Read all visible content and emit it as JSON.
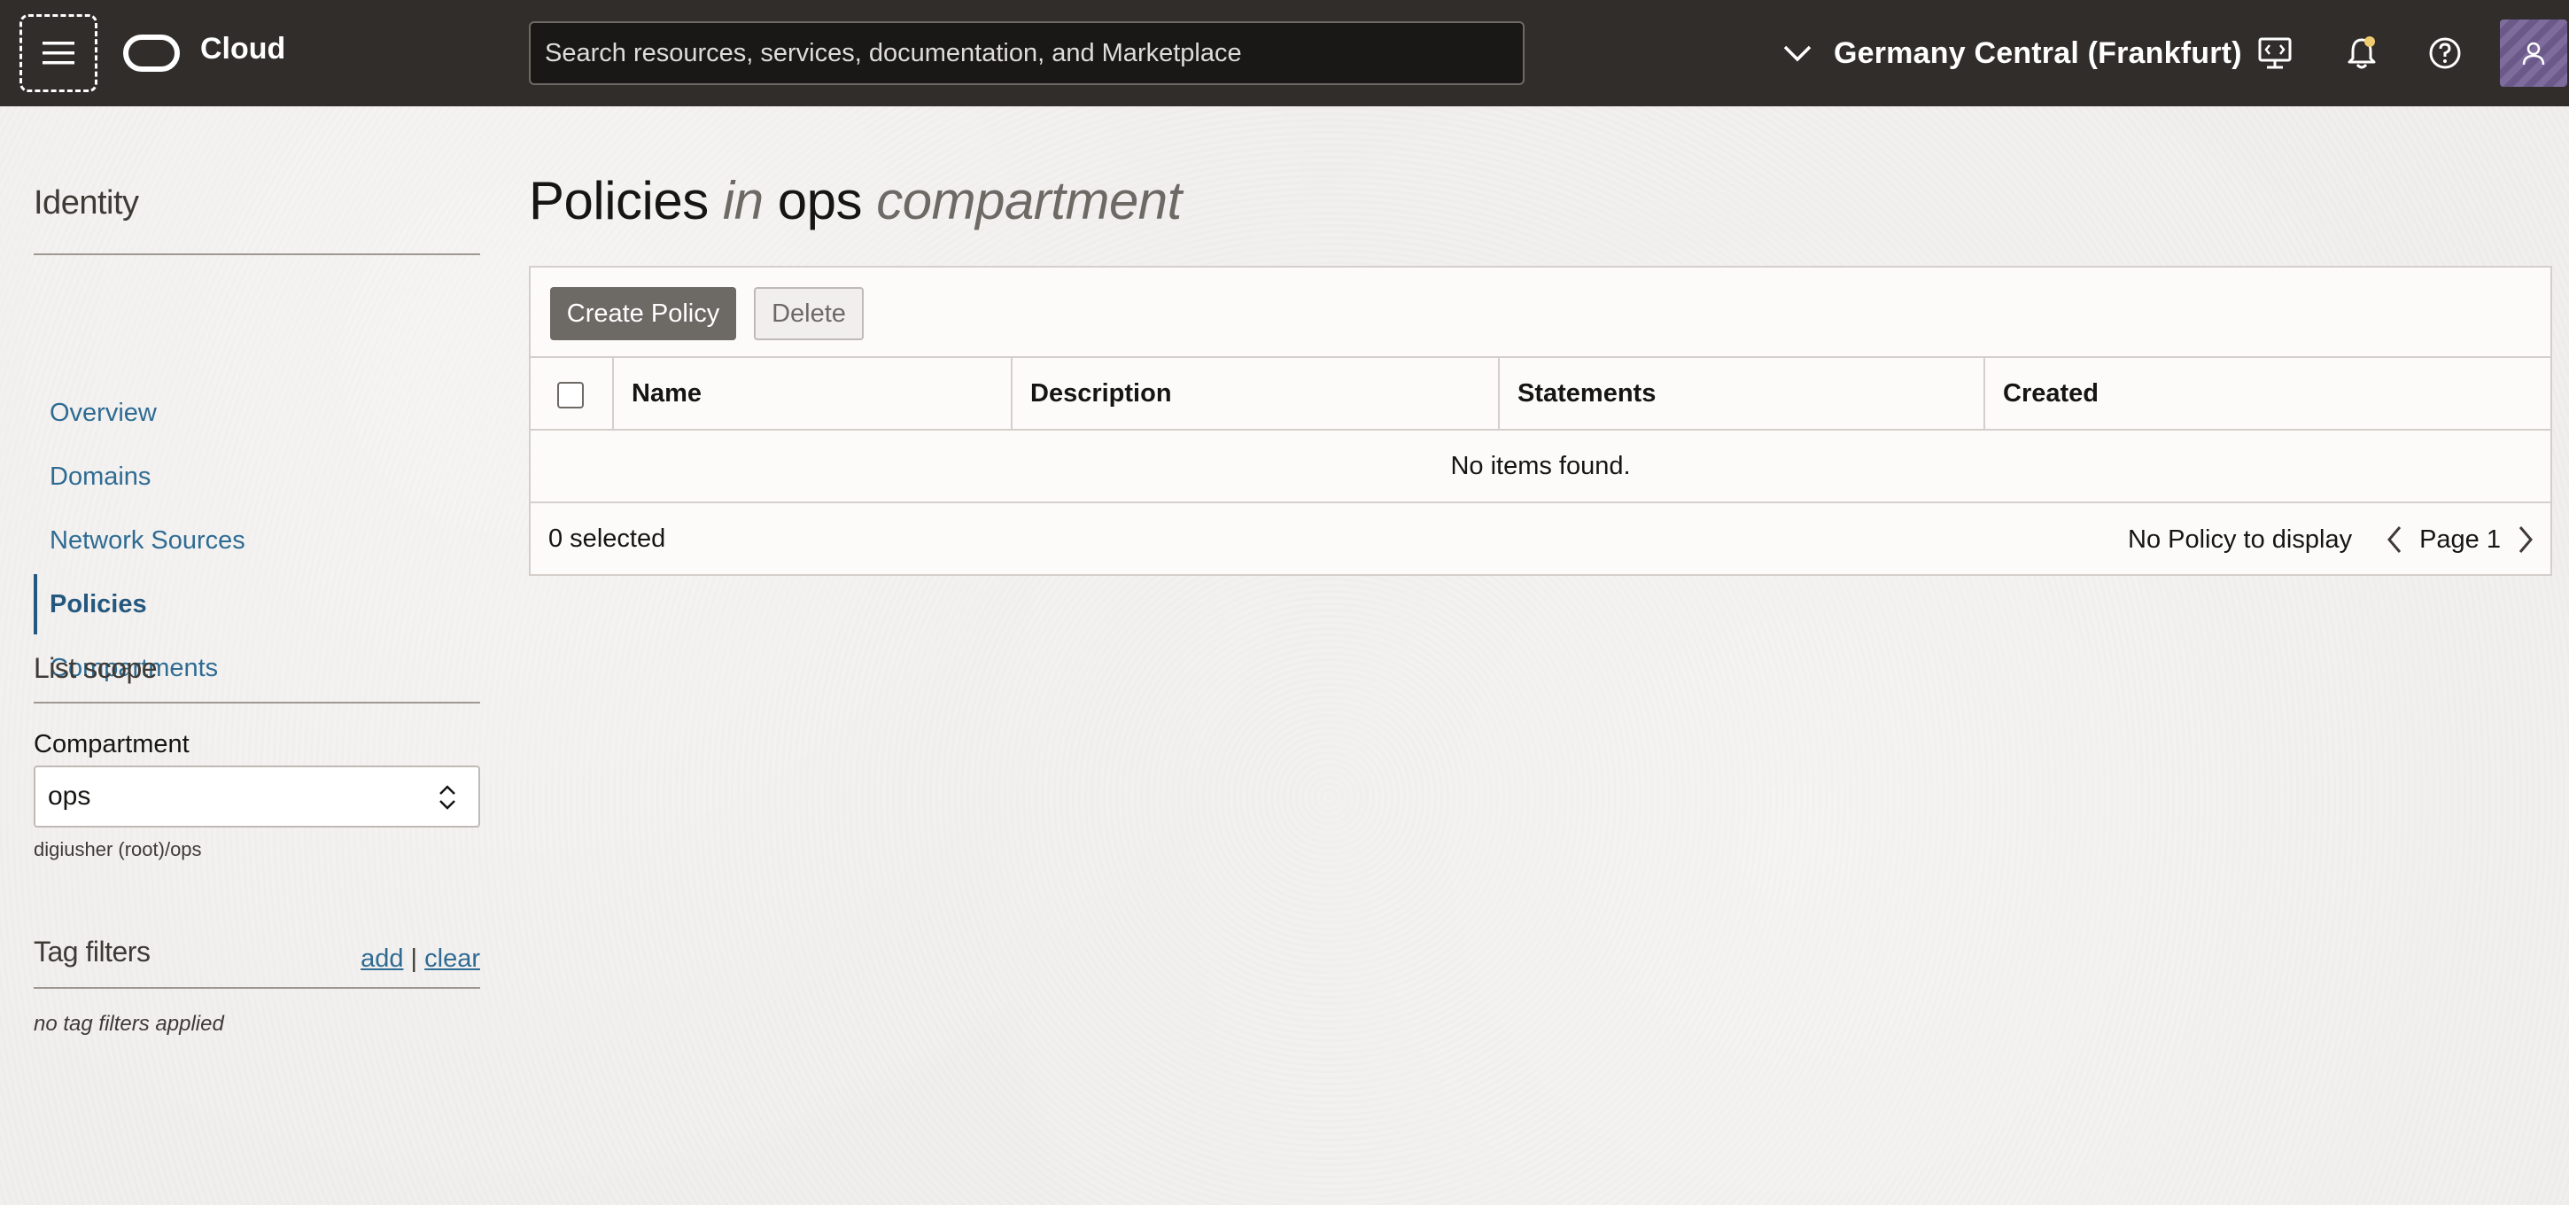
{
  "header": {
    "brand": "Cloud",
    "search_placeholder": "Search resources, services, documentation, and Marketplace",
    "region": "Germany Central (Frankfurt)",
    "icons": [
      "menu-icon",
      "cloud-shell-icon",
      "bell-icon",
      "help-icon",
      "user-icon"
    ],
    "brand_color": "#312d2a",
    "notification_dot_color": "#f0cc71"
  },
  "sidebar": {
    "title": "Identity",
    "nav": [
      {
        "label": "Overview",
        "active": false
      },
      {
        "label": "Domains",
        "active": false
      },
      {
        "label": "Network Sources",
        "active": false
      },
      {
        "label": "Policies",
        "active": true
      },
      {
        "label": "Compartments",
        "active": false
      }
    ],
    "list_scope": {
      "title": "List scope",
      "compartment_label": "Compartment",
      "compartment_value": "ops",
      "compartment_path": "digiusher (root)/ops"
    },
    "tag_filters": {
      "title": "Tag filters",
      "add_label": "add",
      "separator": "|",
      "clear_label": "clear",
      "empty_text": "no tag filters applied"
    },
    "link_color": "#2f6b93"
  },
  "main": {
    "title": {
      "part1": "Policies",
      "part2": "in",
      "part3": "ops",
      "part4": "compartment"
    },
    "toolbar": {
      "create_label": "Create Policy",
      "delete_label": "Delete"
    },
    "table": {
      "columns": [
        "Name",
        "Description",
        "Statements",
        "Created"
      ],
      "empty_text": "No items found.",
      "selected_text": "0 selected",
      "pager_status": "No Policy to display",
      "page_label": "Page 1"
    }
  }
}
